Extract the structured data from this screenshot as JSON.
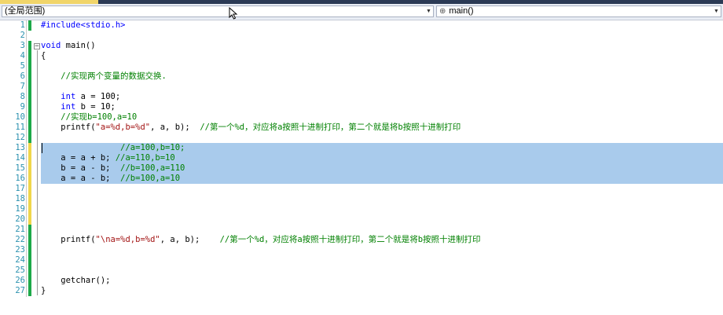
{
  "navbar": {
    "scope": "(全局范围)",
    "member": "main()"
  },
  "lines": [
    {
      "n": "1",
      "parts": [
        {
          "t": "pp",
          "v": "#include<stdio.h>"
        }
      ]
    },
    {
      "n": "2",
      "parts": []
    },
    {
      "n": "3",
      "parts": [
        {
          "t": "kw",
          "v": "void"
        },
        {
          "t": "plain",
          "v": " main()"
        }
      ]
    },
    {
      "n": "4",
      "parts": [
        {
          "t": "plain",
          "v": "{"
        }
      ]
    },
    {
      "n": "5",
      "parts": []
    },
    {
      "n": "6",
      "parts": [
        {
          "t": "plain",
          "v": "    "
        },
        {
          "t": "cm",
          "v": "//实现两个变量的数据交换."
        }
      ]
    },
    {
      "n": "7",
      "parts": []
    },
    {
      "n": "8",
      "parts": [
        {
          "t": "plain",
          "v": "    "
        },
        {
          "t": "kw",
          "v": "int"
        },
        {
          "t": "plain",
          "v": " a = 100;"
        }
      ]
    },
    {
      "n": "9",
      "parts": [
        {
          "t": "plain",
          "v": "    "
        },
        {
          "t": "kw",
          "v": "int"
        },
        {
          "t": "plain",
          "v": " b = 10;"
        }
      ]
    },
    {
      "n": "10",
      "parts": [
        {
          "t": "plain",
          "v": "    "
        },
        {
          "t": "cm",
          "v": "//实现b=100,a=10"
        }
      ]
    },
    {
      "n": "11",
      "parts": [
        {
          "t": "plain",
          "v": "    printf("
        },
        {
          "t": "str",
          "v": "\"a=%d,b=%d\""
        },
        {
          "t": "plain",
          "v": ", a, b);  "
        },
        {
          "t": "cm",
          "v": "//第一个%d，对应将a按照十进制打印，第二个就是将b按照十进制打印"
        }
      ]
    },
    {
      "n": "12",
      "parts": []
    },
    {
      "n": "13",
      "parts": [
        {
          "t": "plain",
          "v": "                "
        },
        {
          "t": "cm",
          "v": "//a=100,b=10;"
        }
      ]
    },
    {
      "n": "14",
      "parts": [
        {
          "t": "plain",
          "v": "    a = a + b; "
        },
        {
          "t": "cm",
          "v": "//a=110,b=10"
        }
      ]
    },
    {
      "n": "15",
      "parts": [
        {
          "t": "plain",
          "v": "    b = a - b;  "
        },
        {
          "t": "cm",
          "v": "//b=100,a=110"
        }
      ]
    },
    {
      "n": "16",
      "parts": [
        {
          "t": "plain",
          "v": "    a = a - b;  "
        },
        {
          "t": "cm",
          "v": "//b=100,a=10"
        }
      ]
    },
    {
      "n": "17",
      "parts": []
    },
    {
      "n": "18",
      "parts": []
    },
    {
      "n": "19",
      "parts": []
    },
    {
      "n": "20",
      "parts": []
    },
    {
      "n": "21",
      "parts": []
    },
    {
      "n": "22",
      "parts": [
        {
          "t": "plain",
          "v": "    printf("
        },
        {
          "t": "str",
          "v": "\"\\na=%d,b=%d\""
        },
        {
          "t": "plain",
          "v": ", a, b);    "
        },
        {
          "t": "cm",
          "v": "//第一个%d，对应将a按照十进制打印，第二个就是将b按照十进制打印"
        }
      ]
    },
    {
      "n": "23",
      "parts": []
    },
    {
      "n": "24",
      "parts": []
    },
    {
      "n": "25",
      "parts": []
    },
    {
      "n": "26",
      "parts": [
        {
          "t": "plain",
          "v": "    getchar();"
        }
      ]
    },
    {
      "n": "27",
      "parts": [
        {
          "t": "plain",
          "v": "}"
        }
      ]
    }
  ]
}
